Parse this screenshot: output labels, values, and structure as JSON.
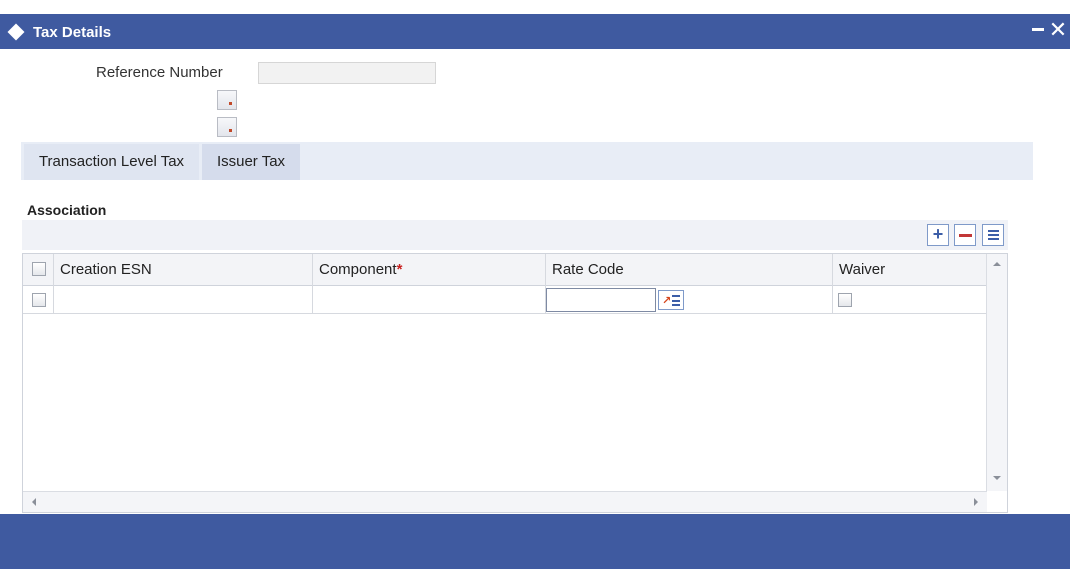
{
  "window": {
    "title": "Tax Details",
    "minimize_icon": "minimize-icon",
    "close_icon": "close-icon",
    "colors": {
      "titlebar": "#3f5aa0",
      "footer": "#3f5aa0",
      "tab_strip": "#e8edf6",
      "required": "#c8201f"
    }
  },
  "form": {
    "reference_number_label": "Reference Number",
    "reference_number_value": "",
    "icons": [
      "document-icon",
      "document-icon"
    ]
  },
  "tabs": [
    {
      "label": "Transaction Level Tax"
    },
    {
      "label": "Issuer Tax"
    }
  ],
  "association": {
    "title": "Association",
    "toolbar": {
      "add_icon": "plus-icon",
      "delete_icon": "minus-icon",
      "view_icon": "list-view-icon"
    },
    "columns": [
      {
        "label": "Creation ESN",
        "required": false
      },
      {
        "label": "Component",
        "required": true,
        "required_mark": "*"
      },
      {
        "label": "Rate Code",
        "required": false
      },
      {
        "label": "Waiver",
        "required": false
      }
    ],
    "rows": [
      {
        "selected": false,
        "creation_esn": "",
        "component": "",
        "rate_code": "",
        "waiver": false
      }
    ]
  }
}
